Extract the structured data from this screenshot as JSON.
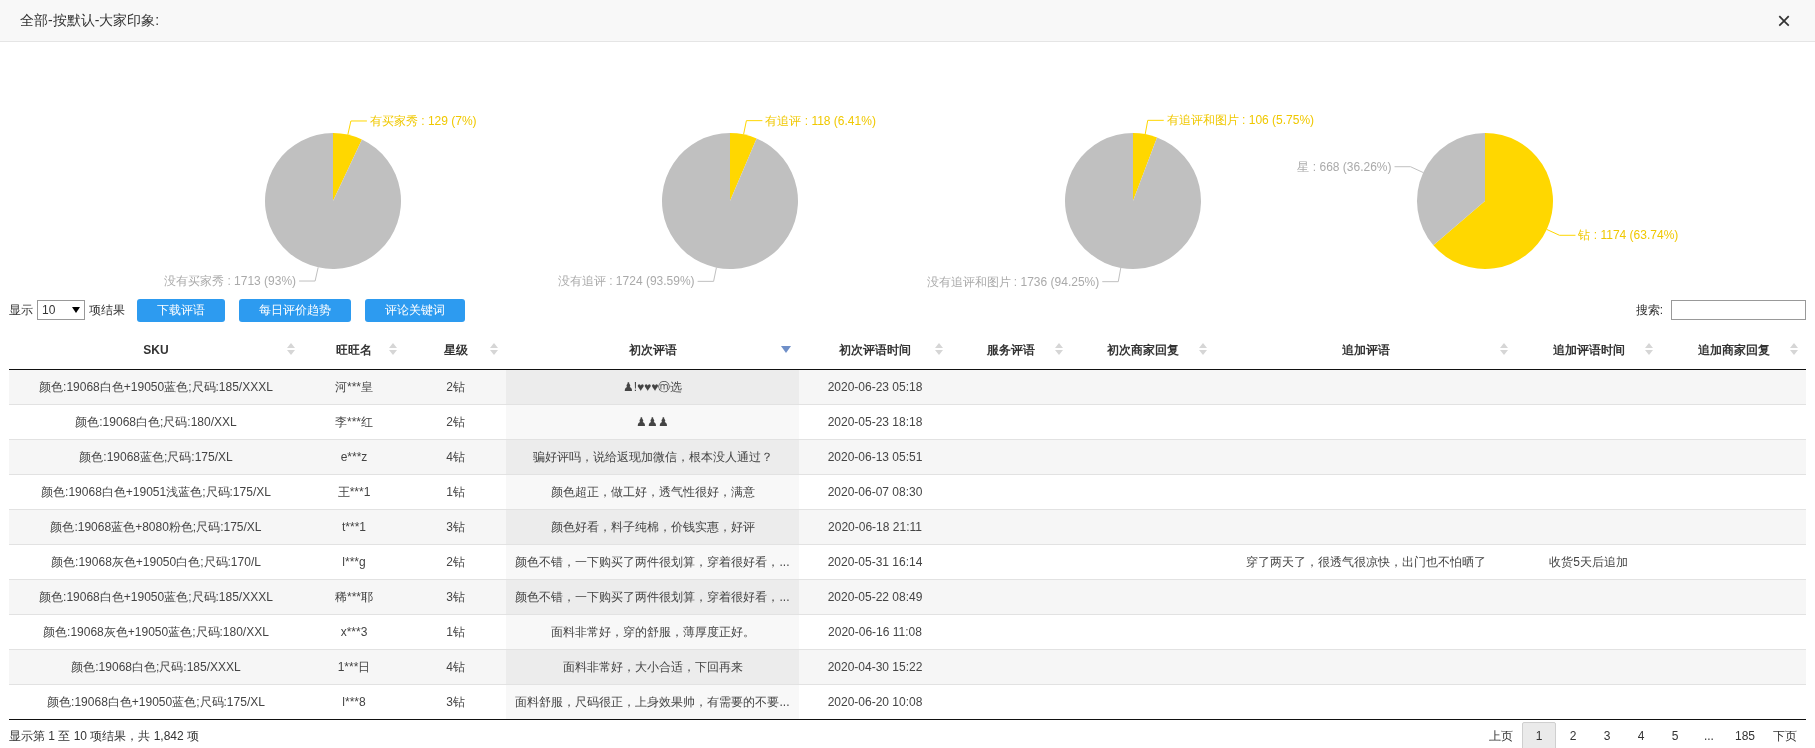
{
  "window": {
    "title": "全部-按默认-大家印象:",
    "close": "×"
  },
  "charts": [
    {
      "chart_data": {
        "type": "pie",
        "values": [
          129,
          1713
        ],
        "value_labels": [
          "有买家秀 : 129 (7%)",
          "没有买家秀 : 1713 (93%)"
        ]
      }
    },
    {
      "chart_data": {
        "type": "pie",
        "values": [
          118,
          1724
        ],
        "value_labels": [
          "有追评 : 118 (6.41%)",
          "没有追评 : 1724 (93.59%)"
        ]
      }
    },
    {
      "chart_data": {
        "type": "pie",
        "values": [
          106,
          1736
        ],
        "value_labels": [
          "有追评和图片 : 106 (5.75%)",
          "没有追评和图片 : 1736 (94.25%)"
        ]
      }
    },
    {
      "chart_data": {
        "type": "pie",
        "values": [
          1174,
          668
        ],
        "value_labels": [
          "钻 : 1174 (63.74%)",
          "星 : 668 (36.26%)"
        ]
      }
    }
  ],
  "controls": {
    "show_label": "显示",
    "page_size": "10",
    "page_size_suffix": "项结果",
    "buttons": [
      "下载评语",
      "每日评价趋势",
      "评论关键词"
    ],
    "search_label": "搜索:"
  },
  "table": {
    "columns": [
      {
        "label": "SKU",
        "sorted": false
      },
      {
        "label": "旺旺名",
        "sorted": false
      },
      {
        "label": "星级",
        "sorted": false
      },
      {
        "label": "初次评语",
        "sorted": true
      },
      {
        "label": "初次评语时间",
        "sorted": false
      },
      {
        "label": "服务评语",
        "sorted": false
      },
      {
        "label": "初次商家回复",
        "sorted": false
      },
      {
        "label": "追加评语",
        "sorted": false
      },
      {
        "label": "追加评语时间",
        "sorted": false
      },
      {
        "label": "追加商家回复",
        "sorted": false
      }
    ],
    "rows": [
      {
        "cells": [
          "颜色:19068白色+19050蓝色;尺码:185/XXXL",
          "河***皇",
          "2钻",
          "♟!♥♥♥ⓜ选",
          "2020-06-23 05:18",
          null,
          null,
          null,
          null,
          null
        ]
      },
      {
        "cells": [
          "颜色:19068白色;尺码:180/XXL",
          "李***红",
          "2钻",
          "♟♟♟",
          "2020-05-23 18:18",
          null,
          null,
          null,
          null,
          null
        ]
      },
      {
        "cells": [
          "颜色:19068蓝色;尺码:175/XL",
          "e***z",
          "4钻",
          "骗好评吗，说给返现加微信，根本没人通过？",
          "2020-06-13 05:51",
          null,
          null,
          null,
          null,
          null
        ]
      },
      {
        "cells": [
          "颜色:19068白色+19051浅蓝色;尺码:175/XL",
          "王***1",
          "1钻",
          "颜色超正，做工好，透气性很好，满意",
          "2020-06-07 08:30",
          null,
          null,
          null,
          null,
          null
        ]
      },
      {
        "cells": [
          "颜色:19068蓝色+8080粉色;尺码:175/XL",
          "t***1",
          "3钻",
          "颜色好看，料子纯棉，价钱实惠，好评",
          "2020-06-18 21:11",
          null,
          null,
          null,
          null,
          null
        ]
      },
      {
        "cells": [
          "颜色:19068灰色+19050白色;尺码:170/L",
          "l***g",
          "2钻",
          "颜色不错，一下购买了两件很划算，穿着很好看，...",
          "2020-05-31 16:14",
          null,
          null,
          "穿了两天了，很透气很凉快，出门也不怕晒了",
          "收货5天后追加",
          null
        ]
      },
      {
        "cells": [
          "颜色:19068白色+19050蓝色;尺码:185/XXXL",
          "稀***耶",
          "3钻",
          "颜色不错，一下购买了两件很划算，穿着很好看，...",
          "2020-05-22 08:49",
          null,
          null,
          null,
          null,
          null
        ]
      },
      {
        "cells": [
          "颜色:19068灰色+19050蓝色;尺码:180/XXL",
          "x***3",
          "1钻",
          "面料非常好，穿的舒服，薄厚度正好。",
          "2020-06-16 11:08",
          null,
          null,
          null,
          null,
          null
        ]
      },
      {
        "cells": [
          "颜色:19068白色;尺码:185/XXXL",
          "1***日",
          "4钻",
          "面料非常好，大小合适，下回再来",
          "2020-04-30 15:22",
          null,
          null,
          null,
          null,
          null
        ]
      },
      {
        "cells": [
          "颜色:19068白色+19050蓝色;尺码:175/XL",
          "l***8",
          "3钻",
          "面料舒服，尺码很正，上身效果帅，有需要的不要...",
          "2020-06-20 10:08",
          null,
          null,
          null,
          null,
          null
        ]
      }
    ]
  },
  "footer": {
    "info": "显示第 1 至 10 项结果，共 1,842 项",
    "pagination": [
      {
        "label": "上页",
        "selected": false
      },
      {
        "label": "1",
        "selected": true
      },
      {
        "label": "2",
        "selected": false
      },
      {
        "label": "3",
        "selected": false
      },
      {
        "label": "4",
        "selected": false
      },
      {
        "label": "5",
        "selected": false
      },
      {
        "label": "...",
        "selected": false
      },
      {
        "label": "185",
        "selected": false
      },
      {
        "label": "下页",
        "selected": false
      }
    ]
  }
}
